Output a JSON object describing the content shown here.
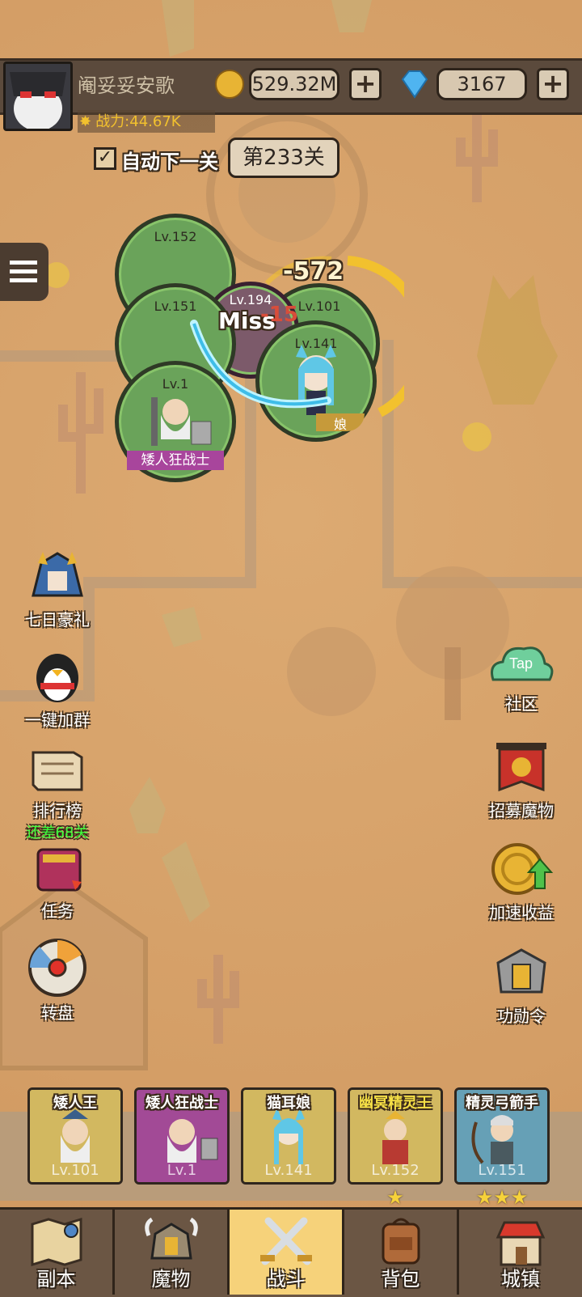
{
  "player": {
    "name": "阉妥妥安歌",
    "power": "战力:44.67K"
  },
  "currency": {
    "gold": "529.32M",
    "gems": "3167",
    "plus": "+"
  },
  "stage": {
    "auto_next": "自动下一关",
    "level": "第233关"
  },
  "battle": {
    "damage": "-572",
    "miss": "Miss",
    "dmg2": "-15",
    "units": [
      {
        "lv": "Lv.152"
      },
      {
        "lv": "Lv.151"
      },
      {
        "lv": "Lv.194"
      },
      {
        "lv": "Lv.101"
      },
      {
        "lv": "Lv.141"
      },
      {
        "lv": "Lv.1",
        "name": "矮人狂战士"
      }
    ],
    "tag_partial": "娘"
  },
  "left_menu": [
    {
      "label": "七日豪礼"
    },
    {
      "label": "一键加群"
    },
    {
      "label": "排行榜",
      "sub": "还差68关"
    },
    {
      "label": "任务"
    },
    {
      "label": "转盘"
    }
  ],
  "right_menu": [
    {
      "label": "社区",
      "badge": "Tap"
    },
    {
      "label": "招募魔物"
    },
    {
      "label": "加速收益"
    },
    {
      "label": "功勋令"
    }
  ],
  "team": [
    {
      "name": "矮人王",
      "lv": "Lv.101",
      "stars": ""
    },
    {
      "name": "矮人狂战士",
      "lv": "Lv.1",
      "stars": ""
    },
    {
      "name": "猫耳娘",
      "lv": "Lv.141",
      "stars": ""
    },
    {
      "name": "幽冥精灵王",
      "lv": "Lv.152",
      "stars": "★"
    },
    {
      "name": "精灵弓箭手",
      "lv": "Lv.151",
      "stars": "★★★"
    }
  ],
  "nav": [
    {
      "label": "副本"
    },
    {
      "label": "魔物"
    },
    {
      "label": "战斗"
    },
    {
      "label": "背包"
    },
    {
      "label": "城镇"
    }
  ],
  "colors": {
    "accent_gold": "#f2c12e",
    "unit_green": "#6aa35a",
    "sub_green": "#3cff3c",
    "nav_active": "#f6d27a"
  }
}
